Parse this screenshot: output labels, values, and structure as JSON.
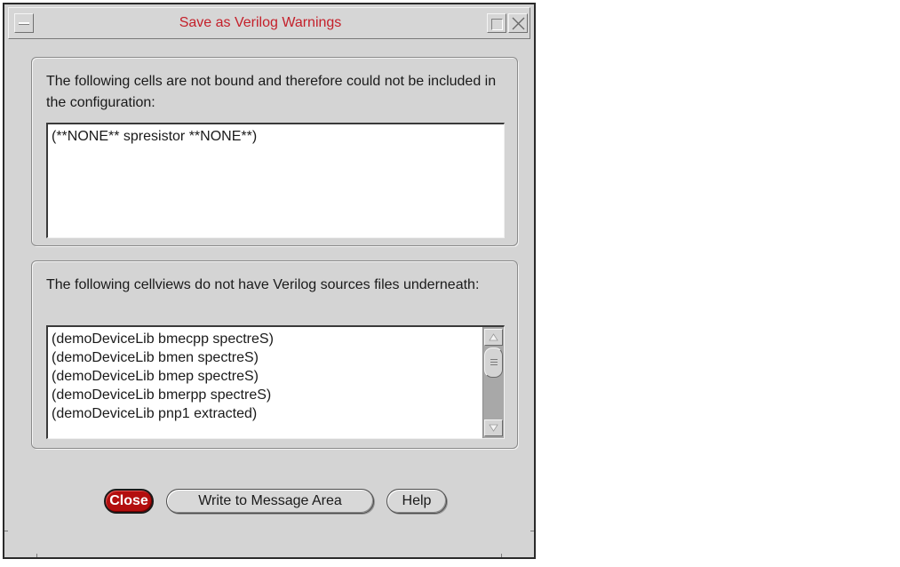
{
  "window": {
    "title": "Save as Verilog Warnings",
    "title_color": "#c4202a",
    "controls": {
      "menu_icon": "window-menu-icon",
      "maximize_icon": "maximize-icon",
      "close_icon": "close-icon"
    }
  },
  "unbound_cells": {
    "label": "The following cells are not bound and therefore could not be included in the configuration:",
    "items": [
      "(**NONE** spresistor **NONE**)"
    ]
  },
  "missing_sources": {
    "label": "The following cellviews do not have Verilog sources files underneath:",
    "items": [
      "(demoDeviceLib bmecpp spectreS)",
      "(demoDeviceLib bmen spectreS)",
      "(demoDeviceLib bmep spectreS)",
      "(demoDeviceLib bmerpp spectreS)",
      "(demoDeviceLib pnp1 extracted)"
    ]
  },
  "buttons": {
    "close": "Close",
    "write": "Write to Message Area",
    "help": "Help",
    "close_color": "#b30e0e"
  }
}
